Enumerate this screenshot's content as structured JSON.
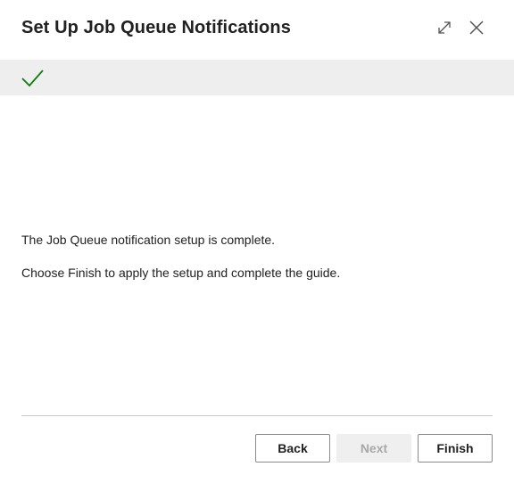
{
  "dialog": {
    "title": "Set Up Job Queue Notifications",
    "header_icons": [
      "expand-icon",
      "close-icon"
    ]
  },
  "status_banner": {
    "icon": "checkmark-icon",
    "icon_color": "#107c10",
    "background": "#eeeeee"
  },
  "content": {
    "line1": "The Job Queue notification setup is complete.",
    "line2": "Choose Finish to apply the setup and complete the guide."
  },
  "footer": {
    "back_label": "Back",
    "next_label": "Next",
    "next_enabled": false,
    "finish_label": "Finish"
  }
}
